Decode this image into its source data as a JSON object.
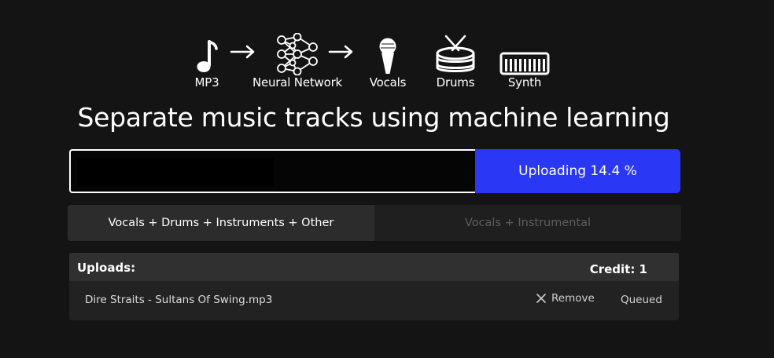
{
  "pipeline": {
    "steps": [
      {
        "label": "MP3",
        "icon": "music-note-icon"
      },
      {
        "label": "Neural Network",
        "icon": "neural-network-icon"
      },
      {
        "label": "Vocals",
        "icon": "microphone-icon"
      },
      {
        "label": "Drums",
        "icon": "drum-icon"
      },
      {
        "label": "Synth",
        "icon": "keyboard-icon"
      }
    ]
  },
  "headline": "Separate music tracks using machine learning",
  "upload": {
    "button_label": "Uploading 14.4 %",
    "progress_percent": 14.4,
    "accent_color": "#2a37f5"
  },
  "modes": {
    "tabs": [
      {
        "label": "Vocals + Drums + Instruments + Other",
        "active": true
      },
      {
        "label": "Vocals + Instrumental",
        "active": false
      }
    ]
  },
  "uploads": {
    "title": "Uploads:",
    "credit": "Credit: 1",
    "rows": [
      {
        "file": "Dire Straits - Sultans Of Swing.mp3",
        "remove_label": "Remove",
        "status": "Queued"
      }
    ]
  }
}
